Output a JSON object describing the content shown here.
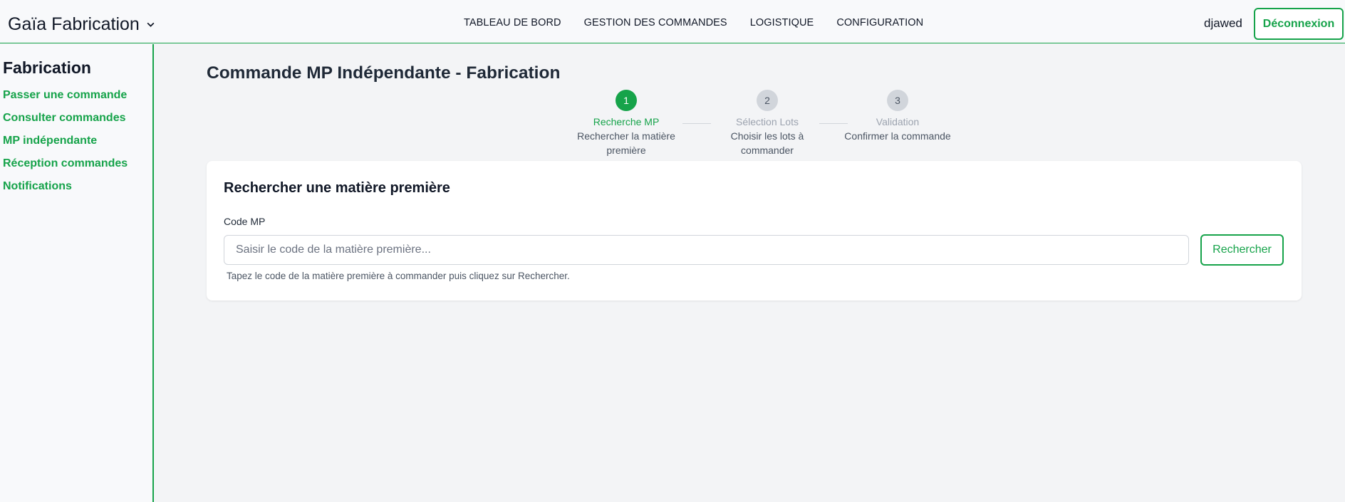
{
  "header": {
    "brand": "Gaïa Fabrication",
    "nav": [
      {
        "label": "TABLEAU DE BORD"
      },
      {
        "label": "GESTION DES COMMANDES"
      },
      {
        "label": "LOGISTIQUE"
      },
      {
        "label": "CONFIGURATION"
      }
    ],
    "username": "djawed",
    "logout_label": "Déconnexion"
  },
  "sidebar": {
    "title": "Fabrication",
    "items": [
      {
        "label": "Passer une commande"
      },
      {
        "label": "Consulter commandes"
      },
      {
        "label": "MP indépendante"
      },
      {
        "label": "Réception commandes"
      },
      {
        "label": "Notifications"
      }
    ]
  },
  "main": {
    "title": "Commande MP Indépendante - Fabrication",
    "stepper": [
      {
        "number": "1",
        "label": "Recherche MP",
        "description": "Rechercher la matière première",
        "state": "active"
      },
      {
        "number": "2",
        "label": "Sélection Lots",
        "description": "Choisir les lots à commander",
        "state": "inactive"
      },
      {
        "number": "3",
        "label": "Validation",
        "description": "Confirmer la commande",
        "state": "inactive"
      }
    ],
    "card": {
      "title": "Rechercher une matière première",
      "field_label": "Code MP",
      "input_value": "",
      "placeholder": "Saisir le code de la matière première...",
      "button_label": "Rechercher",
      "help_text": "Tapez le code de la matière première à commander puis cliquez sur Rechercher."
    }
  },
  "colors": {
    "accent": "#16a34a",
    "inactive_step": "#d1d5db",
    "background": "#f3f4f6"
  }
}
